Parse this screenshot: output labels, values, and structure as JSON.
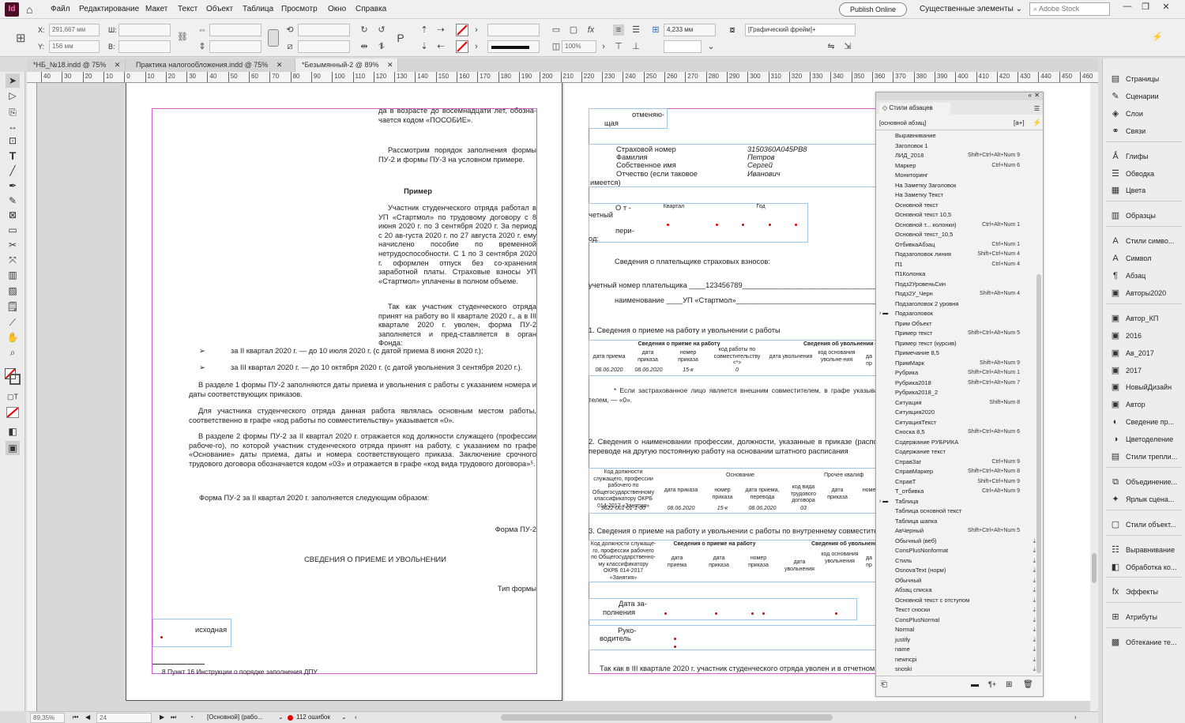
{
  "app": {
    "logo": "Id",
    "home_icon": "home-icon"
  },
  "menu": [
    "Файл",
    "Редактирование",
    "Макет",
    "Текст",
    "Объект",
    "Таблица",
    "Просмотр",
    "Окно",
    "Справка"
  ],
  "header": {
    "publish": "Publish Online",
    "workspace": "Существенные элементы",
    "search_placeholder": "Adobe Stock"
  },
  "control": {
    "x_label": "X:",
    "x_value": "291,667 мм",
    "y_label": "Y:",
    "y_value": "156 мм",
    "w_label": "Ш:",
    "h_label": "В:",
    "zoom": "100%",
    "offset": "4,233 мм",
    "frame_style": "[Графический фрейм]+"
  },
  "tabs": [
    {
      "label": "*НБ_№18.indd @ 75%"
    },
    {
      "label": "Практика налогообложения.indd @ 75%"
    },
    {
      "label": "*Безымянный-2 @ 89%"
    }
  ],
  "ruler": [
    "40",
    "30",
    "20",
    "10",
    "0",
    "10",
    "20",
    "30",
    "40",
    "50",
    "60",
    "70",
    "80",
    "90",
    "100",
    "110",
    "120",
    "130",
    "140",
    "150",
    "160",
    "170",
    "180",
    "190",
    "200",
    "210",
    "220",
    "230",
    "240",
    "250",
    "260",
    "270",
    "280",
    "290",
    "300",
    "310",
    "320",
    "330",
    "340",
    "350",
    "360",
    "370",
    "380",
    "390",
    "400",
    "410",
    "420",
    "430",
    "440",
    "450",
    "460"
  ],
  "left": {
    "p1": "да в возрасте до восемнадцати лет, обозна-чается кодом «ПОСОБИЕ».",
    "p2": "Рассмотрим порядок заполнения формы ПУ-2 и формы ПУ-3 на условном примере.",
    "example": "Пример",
    "p3": "Участник студенческого отряда работал в УП «Стартмол» по трудовому договору с 8 июня 2020 г. по 3 сентября 2020 г. За период с 20 ав-густа 2020 г. по 27 августа 2020 г. ему начислено пособие по временной нетрудоспособности. С 1 по 3 сентября 2020 г. оформлен отпуск без со-хранения заработной платы. Страховые взносы УП «Стартмол» уплачены в полном объеме.",
    "p4": "Так как участник студенческого отряда принят на работу во II квартале 2020 г., а в III квартале 2020 г. уволен, форма ПУ-2 заполняется и пред-ставляется в орган Фонда:",
    "b1": "за II квартал 2020 г. — до 10 июля 2020 г. (с датой приема 8 июня 2020 г.);",
    "b2": "за III квартал 2020 г. — до 10 октября 2020 г. (с датой увольнения 3 сентября 2020 г.).",
    "p5": "В разделе 1 формы ПУ-2 заполняются даты приема и увольнения с работы с указанием номера и даты соответствующих приказов.",
    "p6": "Для участника студенческого отряда данная работа являлась основным местом работы, соответственно в графе «код работы по совместительству» указывается «0».",
    "p7": "В разделе 2 формы ПУ-2 за II квартал 2020 г. отражается код должности служащего (профессии рабоче-го), по которой участник студенческого отряда принят на работу, с указанием по графе «Основание» даты приема, даты и номера соответствующего приказа. Заключение срочного трудового договора обозначается кодом «03» и отражается в графе «код вида трудового договора»⁵.",
    "p8": "Форма ПУ-2 за II квартал 2020 г. заполняется следующим образом:",
    "form": "Форма ПУ-2",
    "title": "СВЕДЕНИЯ О ПРИЕМЕ И УВОЛЬНЕНИИ",
    "type": "Тип формы",
    "initial": "исходная",
    "footnote": "8      Пункт 16 Инструкции о порядке заполнения ДПУ"
  },
  "right": {
    "cancel1": "отменяю-",
    "cancel2": "щая",
    "ins_num_l": "Страховой номер",
    "ins_num_v": "3150360A045PB8",
    "fam_l": "Фамилия",
    "fam_v": "Петров",
    "name_l": "Собственное имя",
    "name_v": "Сергей",
    "pat_l": "Отчество   (если   таковое",
    "pat_l2": "имеется)",
    "pat_v": "Иванович",
    "rep1": "О т -",
    "rep2": "четный",
    "rep3": "пери-",
    "rep4": "од:",
    "quarter": "Квартал",
    "year": "Год",
    "payer": "Сведения о плательщике страховых взносов:",
    "acc": "учетный номер плательщика ____123456789______________________________________________",
    "nm": "наименование ____УП «Стартмол»_______________________________________________",
    "s1": "1. Сведения о приеме на работу и увольнении с работы",
    "t1h1": "Сведения о приеме на работу",
    "t1h2": "Сведения об увольнении с",
    "t1c": [
      "дата приема",
      "дата приказа",
      "номер приказа",
      "код работы по совместительству <*>",
      "дата увольнения",
      "код основания увольне-ния",
      "да пр"
    ],
    "t1r": [
      "08.06.2020",
      "08.06.2020",
      "15-к",
      "0"
    ],
    "fn": "* Если застрахованное лицо является внешним совместителем, в графе указывается «1», ес-телем, — «0».",
    "s2": "2. Сведения о наименовании профессии, должности, указанные в приказе (распоряжении) ра переводе на другую постоянную работу на основании штатного расписания",
    "t2c0": "Код должности служащего, профессии рабочего по Общегосударственному классификатору ОКРБ 014-2017 «Занятия»",
    "t2h": "Основание",
    "t2h2": "Прочее квалиф",
    "t2c": [
      "дата приказа",
      "номер приказа",
      "дата приема, перевода",
      "код вида трудового договора",
      "дата приказа",
      "номер"
    ],
    "t2r": [
      "9622-001-01-1-00",
      "08.06.2020",
      "15-к",
      "08.06.2020",
      "03"
    ],
    "s3": "3. Сведения о приеме на работу и увольнении с работы по внутреннему совместительству",
    "t3c0": "Код должности служаще-го, профессии рабочего по Общегосударственно-му классификатору ОКРБ 014-2017 «Занятия»",
    "t3h1": "Сведения о приеме на работу",
    "t3h2": "Сведения об увольнении с",
    "t3c": [
      "дата приема",
      "дата приказа",
      "номер приказа",
      "дата увольнения",
      "код основания увольнения",
      "да пр"
    ],
    "date_l1": "Дата за-",
    "date_l2": "полнения",
    "head_l1": "Руко-",
    "head_l2": "водитель",
    "last": "Так как в III квартале 2020 г. участник студенческого отряда уволен и в отчетном периоде"
  },
  "styles": {
    "title": "Стили абзацев",
    "current": "[основной абзац]",
    "items": [
      {
        "n": "Выравнивание",
        "s": ""
      },
      {
        "n": "Заголовок 1",
        "s": ""
      },
      {
        "n": "ЛИД_2018",
        "s": "Shift+Ctrl+Alt+Num 9"
      },
      {
        "n": "Маркер",
        "s": "Ctrl+Num 6"
      },
      {
        "n": "Мониторинг",
        "s": ""
      },
      {
        "n": "На Заметку Заголовок",
        "s": ""
      },
      {
        "n": "На Заметку Текст",
        "s": ""
      },
      {
        "n": "Основной текст",
        "s": ""
      },
      {
        "n": "Основной текст 10,5",
        "s": ""
      },
      {
        "n": "Основной т... колонки)",
        "s": "Ctrl+Alt+Num 1"
      },
      {
        "n": "Основной текст_10,5",
        "s": ""
      },
      {
        "n": "ОтбивкаАбзац",
        "s": "Ctrl+Num 1"
      },
      {
        "n": "Подзаголовок линия",
        "s": "Shift+Ctrl+Num 4"
      },
      {
        "n": "П1",
        "s": "Ctrl+Num 4"
      },
      {
        "n": "П1Колонка",
        "s": ""
      },
      {
        "n": "Подз2УровеньСин",
        "s": ""
      },
      {
        "n": "Подз2У_Черн",
        "s": "Shift+Alt+Num 4"
      },
      {
        "n": "Подзаголовок 2 уровня",
        "s": ""
      },
      {
        "n": "Подзаголовок",
        "s": ""
      },
      {
        "n": "Прим Объект",
        "s": ""
      },
      {
        "n": "Пример текст",
        "s": "Shift+Ctrl+Alt+Num 5"
      },
      {
        "n": "Пример текст (курсив)",
        "s": ""
      },
      {
        "n": "Примечание 8,5",
        "s": ""
      },
      {
        "n": "ПримМарк",
        "s": "Shift+Alt+Num 9"
      },
      {
        "n": "Рубрика",
        "s": "Shift+Ctrl+Alt+Num 1"
      },
      {
        "n": "Рубрика2018",
        "s": "Shift+Ctrl+Alt+Num 7"
      },
      {
        "n": "Рубрика2018_2",
        "s": ""
      },
      {
        "n": "Ситуация",
        "s": "Shift+Num 8"
      },
      {
        "n": "Ситуация2020",
        "s": ""
      },
      {
        "n": "СитуацияТекст",
        "s": ""
      },
      {
        "n": "Сноска 8,5",
        "s": "Shift+Ctrl+Alt+Num 6"
      },
      {
        "n": "Содержание РУБРИКА",
        "s": ""
      },
      {
        "n": "Содержание текст",
        "s": ""
      },
      {
        "n": "СправЗаг",
        "s": "Ctrl+Num 9"
      },
      {
        "n": "СправМаркер",
        "s": "Shift+Ctrl+Alt+Num 8"
      },
      {
        "n": "СправТ",
        "s": "Shift+Ctrl+Num 9"
      },
      {
        "n": "Т_отбивка",
        "s": "Ctrl+Alt+Num 9"
      },
      {
        "n": "Таблица",
        "s": ""
      },
      {
        "n": "Таблица основной текст",
        "s": ""
      },
      {
        "n": "Таблица шапка",
        "s": ""
      },
      {
        "n": "АвЧерный",
        "s": "Shift+Ctrl+Alt+Num 5"
      },
      {
        "n": "Обычный (веб)",
        "s": ""
      },
      {
        "n": "ConsPlusNonformat",
        "s": ""
      },
      {
        "n": "Стиль",
        "s": ""
      },
      {
        "n": "OsnovaText (норм)",
        "s": ""
      },
      {
        "n": "Обычный",
        "s": ""
      },
      {
        "n": "Абзац списка",
        "s": ""
      },
      {
        "n": "Основной текст с отступом",
        "s": ""
      },
      {
        "n": "Текст сноски",
        "s": ""
      },
      {
        "n": "ConsPlusNormal",
        "s": ""
      },
      {
        "n": "Normal",
        "s": ""
      },
      {
        "n": "justify",
        "s": ""
      },
      {
        "n": "name",
        "s": ""
      },
      {
        "n": "newncpi",
        "s": ""
      },
      {
        "n": "snoski",
        "s": ""
      }
    ]
  },
  "dock": [
    {
      "label": "Страницы",
      "icon": "pages-icon",
      "g": "▤"
    },
    {
      "label": "Сценарии",
      "icon": "scripts-icon",
      "g": "✎"
    },
    {
      "label": "Слои",
      "icon": "layers-icon",
      "g": "◈"
    },
    {
      "label": "Связи",
      "icon": "links-icon",
      "g": "⚭"
    },
    {
      "label": "Глифы",
      "icon": "glyphs-icon",
      "g": "Ǻ"
    },
    {
      "label": "Обводка",
      "icon": "stroke-icon",
      "g": "☰"
    },
    {
      "label": "Цвета",
      "icon": "swatches-icon",
      "g": "▦"
    },
    {
      "label": "Образцы",
      "icon": "samples-icon",
      "g": "▥"
    },
    {
      "label": "Стили симво...",
      "icon": "char-styles-icon",
      "g": "A"
    },
    {
      "label": "Символ",
      "icon": "character-icon",
      "g": "A"
    },
    {
      "label": "Абзац",
      "icon": "paragraph-icon",
      "g": "¶"
    },
    {
      "label": "Авторы2020",
      "icon": "authors2020-icon",
      "g": "▣"
    },
    {
      "label": "Автор_КП",
      "icon": "author-kp-icon",
      "g": "▣"
    },
    {
      "label": "2016",
      "icon": "lib-2016-icon",
      "g": "▣"
    },
    {
      "label": "Ав_2017",
      "icon": "av-2017-icon",
      "g": "▣"
    },
    {
      "label": "2017",
      "icon": "lib-2017-icon",
      "g": "▣"
    },
    {
      "label": "НовыйДизайн",
      "icon": "new-design-icon",
      "g": "▣"
    },
    {
      "label": "Автор",
      "icon": "author-icon",
      "g": "▣"
    },
    {
      "label": "Сведение пр...",
      "icon": "separations-icon",
      "g": "◐"
    },
    {
      "label": "Цветоделение",
      "icon": "color-sep-icon",
      "g": "◑"
    },
    {
      "label": "Стили трепли...",
      "icon": "trap-styles-icon",
      "g": "▤"
    },
    {
      "label": "Объединение...",
      "icon": "merge-icon",
      "g": "⧉"
    },
    {
      "label": "Ярлык сцена...",
      "icon": "script-label-icon",
      "g": "✦"
    },
    {
      "label": "Стили объект...",
      "icon": "object-styles-icon",
      "g": "▢"
    },
    {
      "label": "Выравнивание",
      "icon": "align-icon",
      "g": "☷"
    },
    {
      "label": "Обработка ко...",
      "icon": "pathfinder-icon",
      "g": "◧"
    },
    {
      "label": "Эффекты",
      "icon": "effects-icon",
      "g": "fx"
    },
    {
      "label": "Атрибуты",
      "icon": "attributes-icon",
      "g": "⊞"
    },
    {
      "label": "Обтекание те...",
      "icon": "text-wrap-icon",
      "g": "▩"
    }
  ],
  "status": {
    "zoom": "89,35%",
    "page": "24",
    "style": "[Основной] (рабо...",
    "errors": "112 ошибок"
  }
}
